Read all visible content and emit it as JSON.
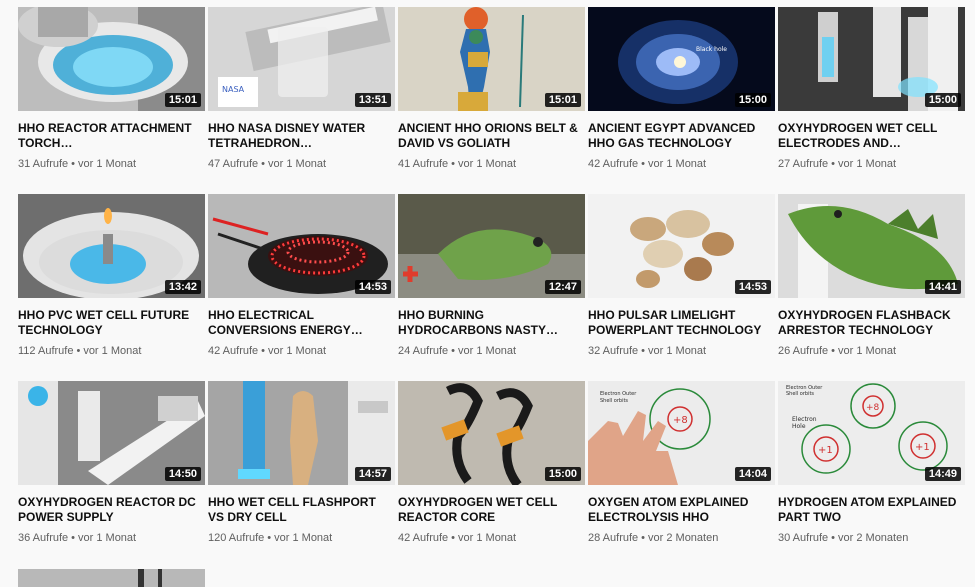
{
  "videos": [
    {
      "title": "HHO REACTOR ATTACHMENT TORCH…",
      "duration": "15:01",
      "views": "31 Aufrufe",
      "age": "vor 1 Monat"
    },
    {
      "title": "HHO NASA DISNEY WATER TETRAHEDRON…",
      "duration": "13:51",
      "views": "47 Aufrufe",
      "age": "vor 1 Monat"
    },
    {
      "title": "ANCIENT HHO ORIONS BELT & DAVID VS GOLIATH",
      "duration": "15:01",
      "views": "41 Aufrufe",
      "age": "vor 1 Monat"
    },
    {
      "title": "ANCIENT EGYPT ADVANCED HHO GAS TECHNOLOGY",
      "duration": "15:00",
      "views": "42 Aufrufe",
      "age": "vor 1 Monat"
    },
    {
      "title": "OXYHYDROGEN WET CELL ELECTRODES AND…",
      "duration": "15:00",
      "views": "27 Aufrufe",
      "age": "vor 1 Monat"
    },
    {
      "title": "HHO PVC WET CELL FUTURE TECHNOLOGY",
      "duration": "13:42",
      "views": "112 Aufrufe",
      "age": "vor 1 Monat"
    },
    {
      "title": "HHO ELECTRICAL CONVERSIONS ENERGY…",
      "duration": "14:53",
      "views": "42 Aufrufe",
      "age": "vor 1 Monat"
    },
    {
      "title": "HHO BURNING HYDROCARBONS NASTY…",
      "duration": "12:47",
      "views": "24 Aufrufe",
      "age": "vor 1 Monat"
    },
    {
      "title": "HHO PULSAR LIMELIGHT POWERPLANT TECHNOLOGY",
      "duration": "14:53",
      "views": "32 Aufrufe",
      "age": "vor 1 Monat"
    },
    {
      "title": "OXYHYDROGEN FLASHBACK ARRESTOR TECHNOLOGY",
      "duration": "14:41",
      "views": "26 Aufrufe",
      "age": "vor 1 Monat"
    },
    {
      "title": "OXYHYDROGEN REACTOR DC POWER SUPPLY",
      "duration": "14:50",
      "views": "36 Aufrufe",
      "age": "vor 1 Monat"
    },
    {
      "title": "HHO WET CELL FLASHPORT VS DRY CELL",
      "duration": "14:57",
      "views": "120 Aufrufe",
      "age": "vor 1 Monat"
    },
    {
      "title": "OXYHYDROGEN WET CELL REACTOR CORE",
      "duration": "15:00",
      "views": "42 Aufrufe",
      "age": "vor 1 Monat"
    },
    {
      "title": "OXYGEN ATOM EXPLAINED ELECTROLYSIS HHO",
      "duration": "14:04",
      "views": "28 Aufrufe",
      "age": "vor 2 Monaten"
    },
    {
      "title": "HYDROGEN ATOM EXPLAINED PART TWO",
      "duration": "14:49",
      "views": "30 Aufrufe",
      "age": "vor 2 Monaten"
    }
  ],
  "separator": "•",
  "thumb_text": {
    "galaxy_label": "Black hole",
    "oxygen_label_1": "Electron Outer",
    "oxygen_label_2": "Shell orbits",
    "oxygen_center": "+8",
    "hydrogen_label_1": "Electron Outer",
    "hydrogen_label_2": "Shell orbits",
    "hydrogen_label_3": "Electron",
    "hydrogen_label_4": "Hole",
    "hydrogen_center_a": "+1",
    "hydrogen_center_b": "+1",
    "hydrogen_center_top": "+8"
  }
}
